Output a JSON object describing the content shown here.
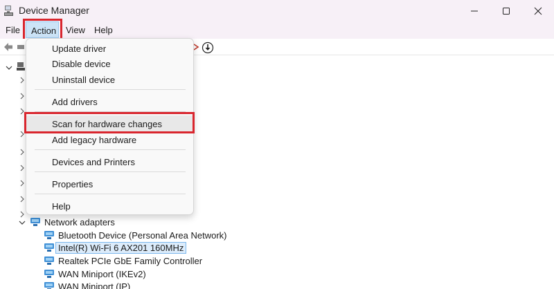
{
  "window": {
    "title": "Device Manager",
    "controls": [
      "minimize",
      "maximize",
      "close"
    ]
  },
  "menubar": {
    "file": "File",
    "action": "Action",
    "view": "View",
    "help": "Help"
  },
  "action_menu": {
    "items": [
      "Update driver",
      "Disable device",
      "Uninstall device",
      "Add drivers",
      "Scan for hardware changes",
      "Add legacy hardware",
      "Devices and Printers",
      "Properties",
      "Help"
    ],
    "highlighted_item": "Scan for hardware changes"
  },
  "tree": {
    "network_adapters": "Network adapters",
    "children": [
      "Bluetooth Device (Personal Area Network)",
      "Intel(R) Wi-Fi 6 AX201 160MHz",
      "Realtek PCIe GbE Family Controller",
      "WAN Miniport (IKEv2)",
      "WAN Miniport (IP)"
    ],
    "selected_child": "Intel(R) Wi-Fi 6 AX201 160MHz"
  },
  "colors": {
    "highlight_border": "#d9262e",
    "menu_selected": "#cce4f7",
    "title_bar": "#f7f0f7"
  }
}
